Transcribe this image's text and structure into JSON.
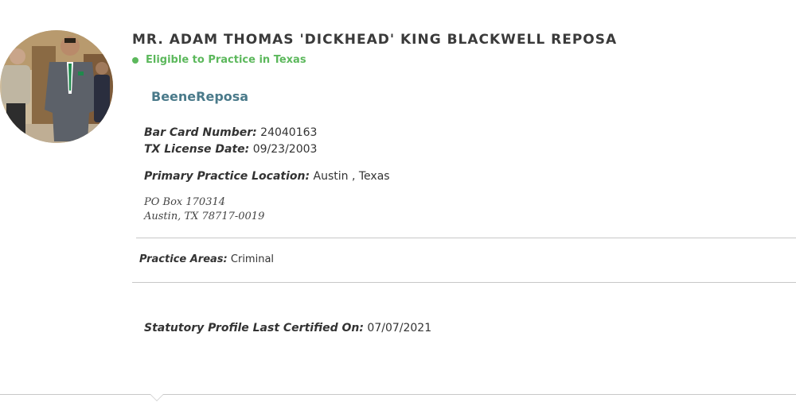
{
  "profile": {
    "name": "MR. ADAM THOMAS 'DICKHEAD' KING BLACKWELL REPOSA",
    "status": "Eligible to Practice in Texas",
    "status_color": "#5cb85c",
    "firm": "BeeneReposa",
    "firm_color": "#4a7a8a",
    "photo_icon": "attorney-photo"
  },
  "details": {
    "bar_card_label": "Bar Card Number:",
    "bar_card_value": "24040163",
    "license_label": "TX License Date:",
    "license_value": "09/23/2003",
    "location_label": "Primary Practice Location:",
    "location_value": "Austin , Texas",
    "address_line1": "PO Box 170314",
    "address_line2": "Austin, TX 78717-0019"
  },
  "practice": {
    "label": "Practice Areas:",
    "value": "Criminal"
  },
  "certified": {
    "label": "Statutory Profile Last Certified On:",
    "value": "07/07/2021"
  }
}
